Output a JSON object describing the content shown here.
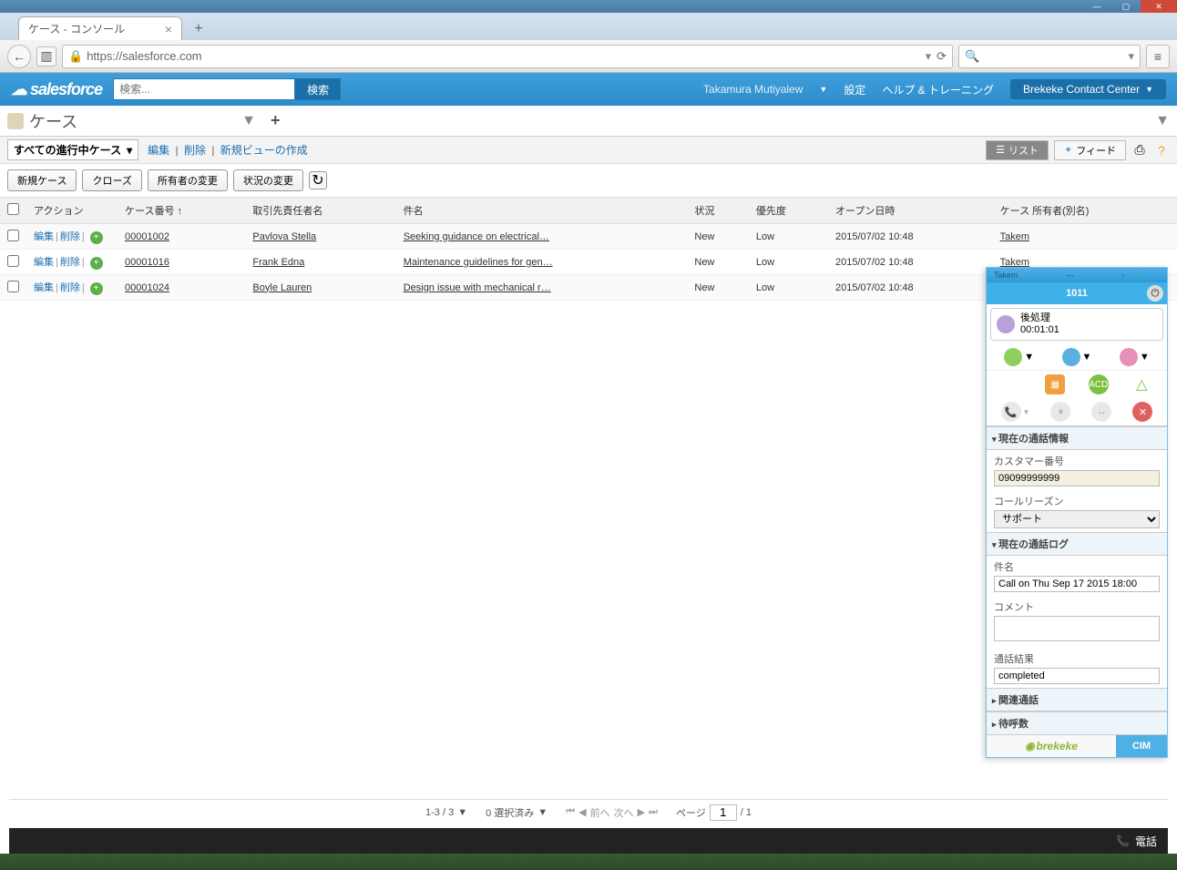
{
  "browser": {
    "tab_title": "ケース - コンソール",
    "url": "https://salesforce.com",
    "search_placeholder": ""
  },
  "sf": {
    "logo": "salesforce",
    "search_placeholder": "検索...",
    "search_btn": "検索",
    "user": "Takamura Mutiyalew",
    "nav_settings": "設定",
    "nav_help": "ヘルプ & トレーニング",
    "app_name": "Brekeke Contact Center"
  },
  "console": {
    "tab_label": "ケース"
  },
  "listview": {
    "view_name": "すべての進行中ケース",
    "link_edit": "編集",
    "link_delete": "削除",
    "link_newview": "新規ビューの作成",
    "btn_list": "リスト",
    "btn_feed": "フィード"
  },
  "actions": {
    "new_case": "新規ケース",
    "close": "クローズ",
    "change_owner": "所有者の変更",
    "change_status": "状況の変更"
  },
  "columns": {
    "action": "アクション",
    "case_no": "ケース番号",
    "contact": "取引先責任者名",
    "subject": "件名",
    "status": "状況",
    "priority": "優先度",
    "opened": "オープン日時",
    "owner": "ケース 所有者(別名)"
  },
  "rows": [
    {
      "edit": "編集",
      "del": "削除",
      "case_no": "00001002",
      "contact": "Pavlova Stella",
      "subject": "Seeking guidance on electrical…",
      "status": "New",
      "priority": "Low",
      "opened": "2015/07/02 10:48",
      "owner": "Takem"
    },
    {
      "edit": "編集",
      "del": "削除",
      "case_no": "00001016",
      "contact": "Frank Edna",
      "subject": "Maintenance guidelines for gen…",
      "status": "New",
      "priority": "Low",
      "opened": "2015/07/02 10:48",
      "owner": "Takem"
    },
    {
      "edit": "編集",
      "del": "削除",
      "case_no": "00001024",
      "contact": "Boyle Lauren",
      "subject": "Design issue with mechanical r…",
      "status": "New",
      "priority": "Low",
      "opened": "2015/07/02 10:48",
      "owner": ""
    }
  ],
  "pagination": {
    "range": "1-3 / 3",
    "selected": "0 選択済み",
    "prev": "前へ",
    "next": "次へ",
    "page_label": "ページ",
    "page_current": "1",
    "page_total": "/ 1"
  },
  "cti": {
    "title_user": "Takem",
    "extension": "1011",
    "status_label": "後処理",
    "status_time": "00:01:01",
    "acd_label": "ACD",
    "section_callinfo": "現在の通話情報",
    "customer_no_label": "カスタマー番号",
    "customer_no": "09099999999",
    "call_reason_label": "コールリーズン",
    "call_reason": "サポート",
    "section_calllog": "現在の通話ログ",
    "subject_label": "件名",
    "subject_value": "Call on Thu Sep 17 2015 18:00",
    "comment_label": "コメント",
    "comment_value": "",
    "result_label": "通話結果",
    "result_value": "completed",
    "section_related": "関連通話",
    "section_waiting": "待呼数",
    "footer_brand": "brekeke",
    "footer_cim": "CIM"
  },
  "bottombar": {
    "phone": "電話"
  }
}
